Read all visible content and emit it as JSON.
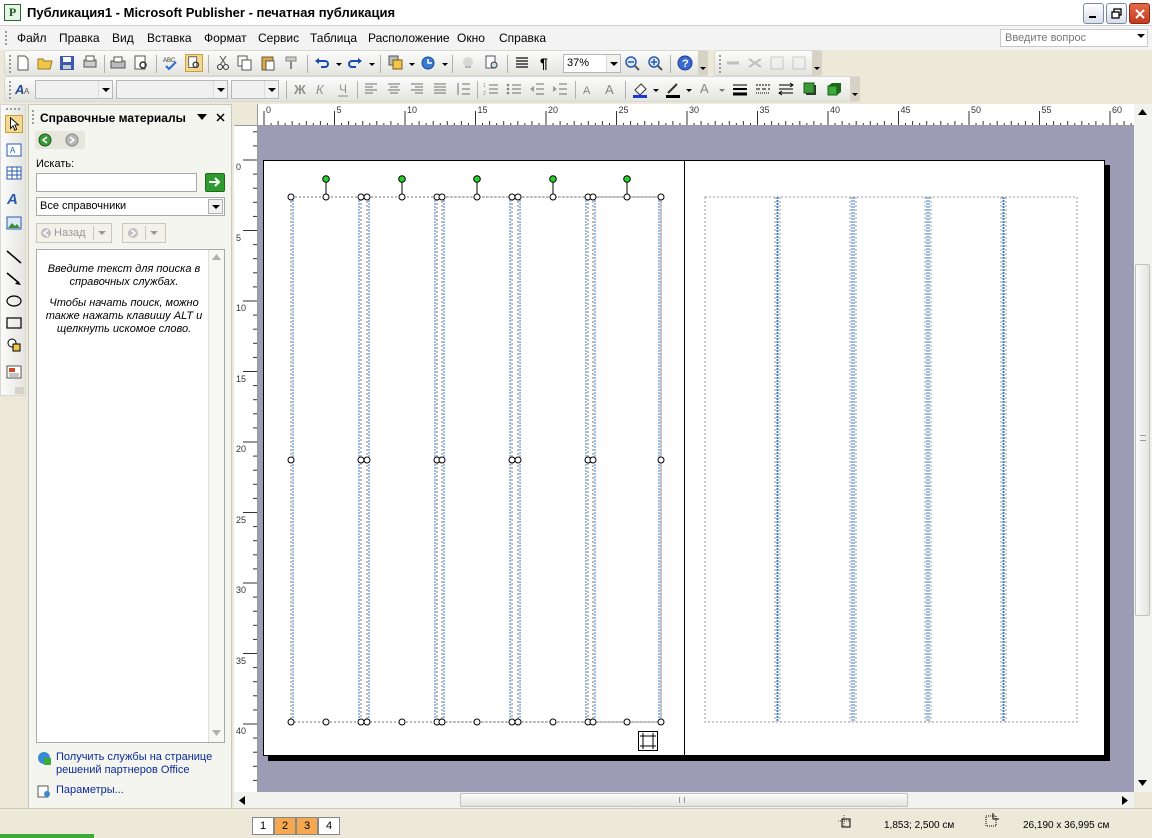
{
  "window": {
    "title": "Публикация1 - Microsoft Publisher - печатная публикация"
  },
  "menu": {
    "items": [
      "Файл",
      "Правка",
      "Вид",
      "Вставка",
      "Формат",
      "Сервис",
      "Таблица",
      "Расположение",
      "Окно",
      "Справка"
    ],
    "ask_placeholder": "Введите вопрос"
  },
  "standard_toolbar": {
    "zoom": "37%"
  },
  "taskpane": {
    "title": "Справочные материалы",
    "search_label": "Искать:",
    "search_value": "",
    "reference_select": "Все справочники",
    "back_button": "Назад",
    "message_1": "Введите текст для поиска в справочных службах.",
    "message_2": "Чтобы начать поиск, можно также нажать клавишу ALT и щелкнуть искомое слово.",
    "link_services": "Получить службы на странице решений партнеров Office",
    "link_options": "Параметры..."
  },
  "rulers": {
    "horizontal": [
      "0",
      "5",
      "10",
      "15",
      "20",
      "25",
      "30",
      "35",
      "40",
      "45",
      "50",
      "55",
      "60"
    ],
    "vertical": [
      "0",
      "5",
      "10",
      "15",
      "20",
      "25",
      "30",
      "35",
      "40"
    ]
  },
  "status": {
    "pages": [
      "1",
      "2",
      "3",
      "4"
    ],
    "active_pages": [
      "2",
      "3"
    ],
    "position": "1,853; 2,500 см",
    "size": "26,190 x 36,995 см"
  }
}
